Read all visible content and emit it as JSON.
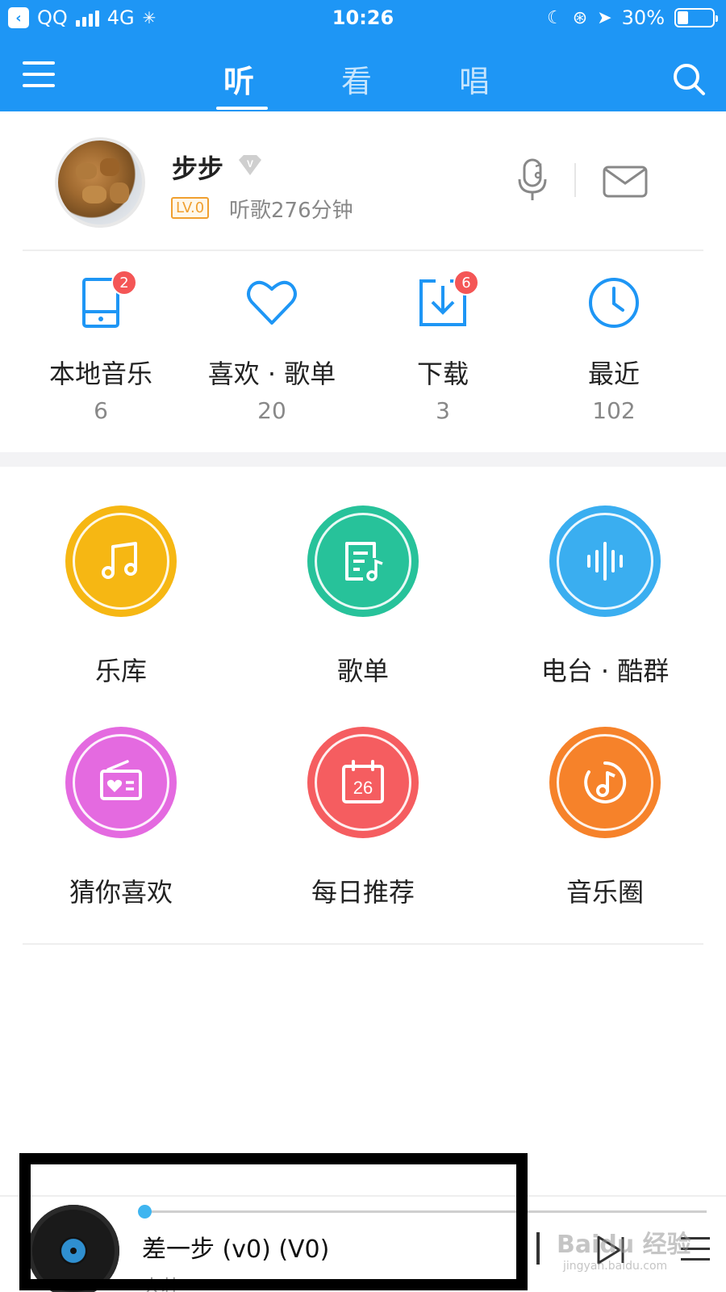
{
  "status_bar": {
    "back_app": "QQ",
    "network": "4G",
    "time": "10:26",
    "battery": "30%",
    "battery_level": 0.3
  },
  "nav": {
    "tabs": [
      {
        "label": "听",
        "active": true
      },
      {
        "label": "看",
        "active": false
      },
      {
        "label": "唱",
        "active": false
      }
    ]
  },
  "profile": {
    "name": "步步",
    "level": "LV.0",
    "listen_time": "听歌276分钟"
  },
  "quick_stats": [
    {
      "label": "本地音乐",
      "count": "6",
      "badge": "2",
      "icon": "tablet-icon"
    },
    {
      "label": "喜欢 · 歌单",
      "count": "20",
      "badge": "",
      "icon": "heart-icon"
    },
    {
      "label": "下载",
      "count": "3",
      "badge": "6",
      "icon": "download-icon"
    },
    {
      "label": "最近",
      "count": "102",
      "badge": "",
      "icon": "clock-icon"
    }
  ],
  "features": [
    {
      "label": "乐库",
      "color": "#f6b713",
      "icon": "music-note-icon"
    },
    {
      "label": "歌单",
      "color": "#27c29a",
      "icon": "playlist-icon"
    },
    {
      "label": "电台 · 酷群",
      "color": "#3aaef0",
      "icon": "soundwave-icon"
    },
    {
      "label": "猜你喜欢",
      "color": "#e46ae0",
      "icon": "radio-heart-icon"
    },
    {
      "label": "每日推荐",
      "color": "#f55d60",
      "icon": "calendar-icon",
      "day": "26"
    },
    {
      "label": "音乐圈",
      "color": "#f6822a",
      "icon": "music-circle-icon"
    }
  ],
  "player": {
    "title": "差一步 (v0) (V0)",
    "artist": "大壮",
    "progress": 0.0
  },
  "watermark": {
    "brand": "Baidu 经验",
    "url": "jingyan.baidu.com"
  },
  "colors": {
    "brand_blue": "#1e96f5",
    "badge_red": "#f45656",
    "level_orange": "#f0a030"
  }
}
